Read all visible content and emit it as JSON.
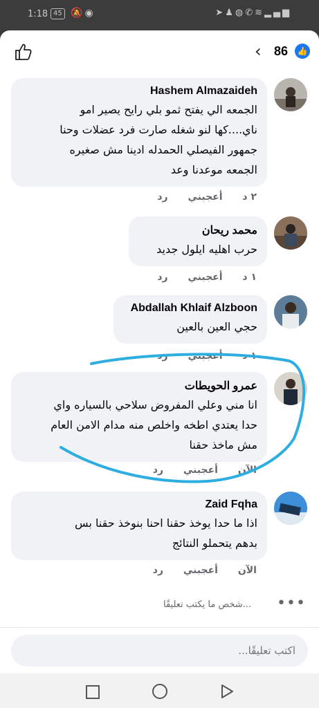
{
  "status_bar": {
    "time": "1:18",
    "battery": "45",
    "left_icons": [
      "battery-icon",
      "mute-icon",
      "eye-icon"
    ],
    "right_icons": [
      "send-icon",
      "person-icon",
      "messenger-icon",
      "whatsapp-icon",
      "wifi-icon",
      "signal-icon"
    ]
  },
  "header": {
    "reaction_count": "86"
  },
  "comments": [
    {
      "name": "Hashem Almazaideh",
      "lines": [
        "الجمعه الي يفتح ثمو بلي رايح يصير امو",
        "ناي....كها لنو شغله صارت فرد عضلات وحنا",
        "جمهور الفيصلي الحمدله ادينا مش صغيره",
        "الجمعه موعدنا وعد"
      ],
      "time": "٢ د",
      "like": "أعجبني",
      "reply": "رد"
    },
    {
      "name": "محمد ريحان",
      "lines": [
        "حرب اهليه ايلول جديد"
      ],
      "time": "١ د",
      "like": "أعجبني",
      "reply": "رد"
    },
    {
      "name": "Abdallah Khlaif Alzboon",
      "lines": [
        "حجي العين بالعين"
      ],
      "time": "١ د",
      "like": "أعجبني",
      "reply": "رد"
    },
    {
      "name": "عمرو الحويطات",
      "lines": [
        "انا مني وعلي المفروض سلاحي بالسياره واي",
        "حدا يعتدي اطخه واخلص منه مدام الامن العام",
        "مش ماخذ حقنا"
      ],
      "time": "الآن",
      "like": "أعجبني",
      "reply": "رد"
    },
    {
      "name": "Zaid Fqha",
      "lines": [
        "اذا ما حدا يوخذ حقنا احنا بنوخذ حقنا بس",
        "بدهم يتحملو النتائج"
      ],
      "time": "الآن",
      "like": "أعجبني",
      "reply": "رد"
    }
  ],
  "typing_indicator": "شخص ما يكتب تعليقًا...",
  "composer": {
    "placeholder": "اكتب تعليقًا..."
  },
  "colors": {
    "accent": "#1877f2",
    "bubble": "#f0f2f5",
    "annotation": "#2eaee0"
  }
}
